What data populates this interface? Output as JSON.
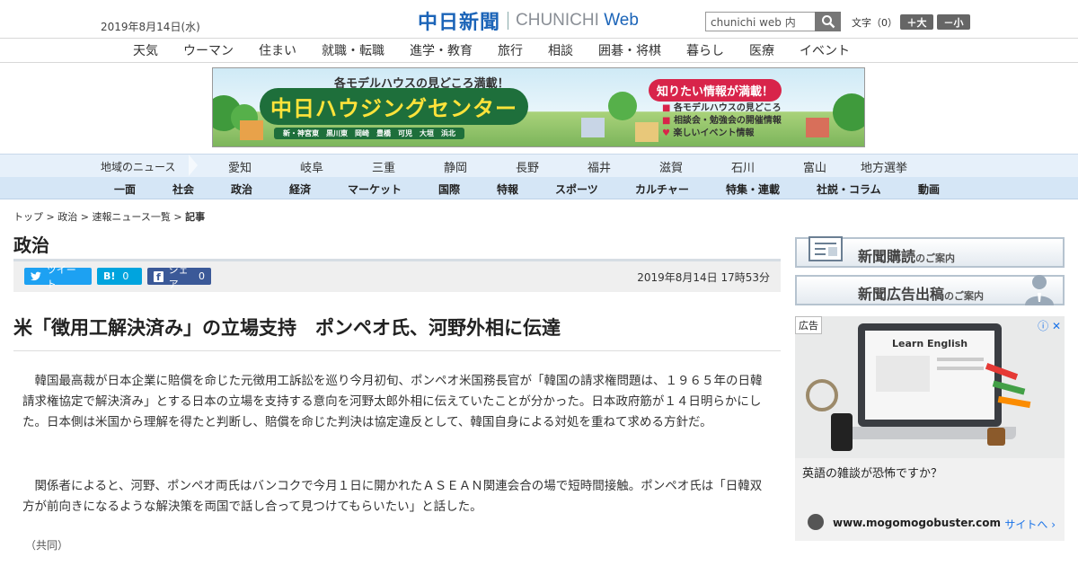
{
  "header": {
    "date": "2019年8月14日(水)",
    "logo_jp": "中日新聞",
    "logo_en_a": "CHUNICHI ",
    "logo_en_b": "Web",
    "search_value": "chunichi web 内",
    "font_size_label": "文字（0）",
    "font_plus": "＋大",
    "font_minus": "－小"
  },
  "top_nav": [
    "天気",
    "ウーマン",
    "住まい",
    "就職・転職",
    "進学・教育",
    "旅行",
    "相談",
    "囲碁・将棋",
    "暮らし",
    "医療",
    "イベント"
  ],
  "banner": {
    "top_text": "各モデルハウスの見どころ満載！",
    "main": "中日ハウジングセンター",
    "cities": [
      "新・神宮東",
      "黒川東",
      "岡崎",
      "豊橋",
      "可児",
      "大垣",
      "浜北"
    ],
    "right_title": "知りたい情報が満載！",
    "right_items": [
      "各モデルハウスの見どころ",
      "相談会・勉強会の開催情報",
      "楽しいイベント情報"
    ]
  },
  "region_nav": {
    "label": "地域のニュース",
    "items": [
      "愛知",
      "岐阜",
      "三重",
      "静岡",
      "長野",
      "福井",
      "滋賀",
      "石川",
      "富山",
      "地方選挙"
    ]
  },
  "section_nav": [
    "一面",
    "社会",
    "政治",
    "経済",
    "マーケット",
    "国際",
    "特報",
    "スポーツ",
    "カルチャー",
    "特集・連載",
    "社説・コラム",
    "動画"
  ],
  "breadcrumb": {
    "items": [
      "トップ",
      "政治",
      "速報ニュース一覧"
    ],
    "current": "記事",
    "sep": " > "
  },
  "section_title": "政治",
  "share": {
    "tweet": "ツイート",
    "hatena": "B!",
    "hatena_count": "0",
    "facebook": "シェア",
    "facebook_count": "0"
  },
  "article": {
    "published": "2019年8月14日 17時53分",
    "headline": "米「徴用工解決済み」の立場支持　ポンペオ氏、河野外相に伝達",
    "paragraphs": [
      "韓国最高裁が日本企業に賠償を命じた元徴用工訴訟を巡り今月初旬、ポンペオ米国務長官が「韓国の請求権問題は、１９６５年の日韓請求権協定で解決済み」とする日本の立場を支持する意向を河野太郎外相に伝えていたことが分かった。日本政府筋が１４日明らかにした。日本側は米国から理解を得たと判断し、賠償を命じた判決は協定違反として、韓国自身による対処を重ねて求める方針だ。",
      "関係者によると、河野、ポンペオ両氏はバンコクで今月１日に開かれたＡＳＥＡＮ関連会合の場で短時間接触。ポンペオ氏は「日韓双方が前向きになるような解決策を両国で話し合って見つけてもらいたい」と話した。"
    ],
    "credit": "（共同）"
  },
  "sidebar": {
    "subscribe": {
      "main": "新聞購読",
      "small": "のご案内"
    },
    "advertise": {
      "main": "新聞広告出稿",
      "small": "のご案内"
    },
    "ad": {
      "badge": "広告",
      "screen_text": "Learn English",
      "title": "英語の雑談が恐怖ですか？",
      "url": "www.mogomogobuster.com",
      "site_link": "サイトへ"
    }
  },
  "colors": {
    "brand_blue": "#1b64b8",
    "twitter": "#1da1f2",
    "hatena": "#00a4de",
    "facebook": "#3b5998",
    "nav_bg": "#e6f0fa"
  }
}
